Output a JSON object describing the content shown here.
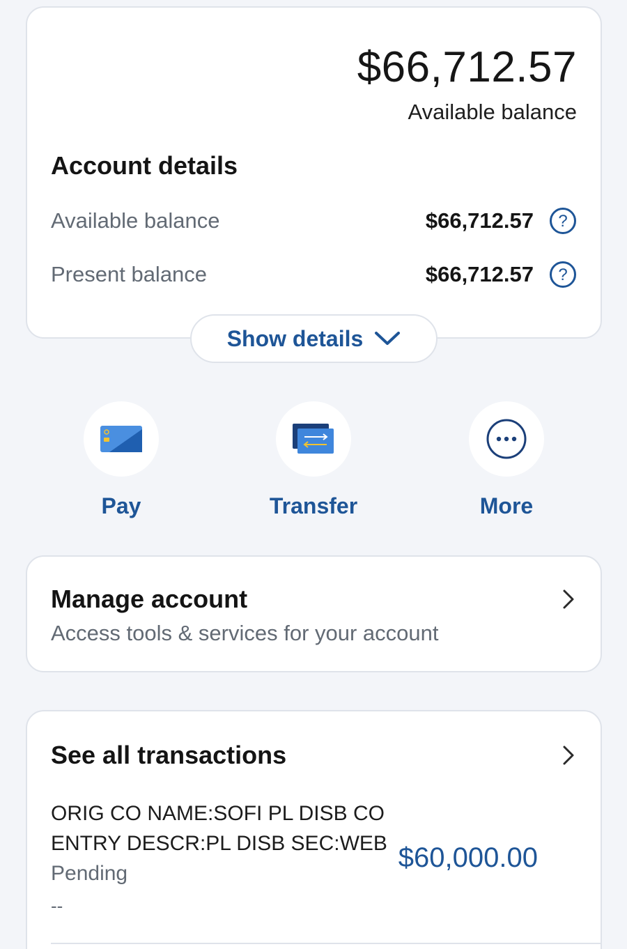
{
  "balance": {
    "amount": "$66,712.57",
    "caption": "Available balance"
  },
  "account_details": {
    "title": "Account details",
    "rows": [
      {
        "label": "Available balance",
        "value": "$66,712.57"
      },
      {
        "label": "Present balance",
        "value": "$66,712.57"
      }
    ],
    "show_details_label": "Show details"
  },
  "actions": [
    {
      "label": "Pay",
      "icon": "card-icon"
    },
    {
      "label": "Transfer",
      "icon": "transfer-icon"
    },
    {
      "label": "More",
      "icon": "more-icon"
    }
  ],
  "manage": {
    "title": "Manage account",
    "subtitle": "Access tools & services for your account"
  },
  "transactions": {
    "title": "See all transactions",
    "items": [
      {
        "line1": "ORIG CO NAME:SOFI PL DISB CO",
        "line2": "ENTRY DESCR:PL DISB SEC:WEB",
        "status": "Pending",
        "date": "--",
        "amount": "$60,000.00"
      }
    ]
  },
  "colors": {
    "accent": "#1e5597",
    "background": "#f3f5f9",
    "card": "#ffffff",
    "muted_text": "#626a74"
  }
}
